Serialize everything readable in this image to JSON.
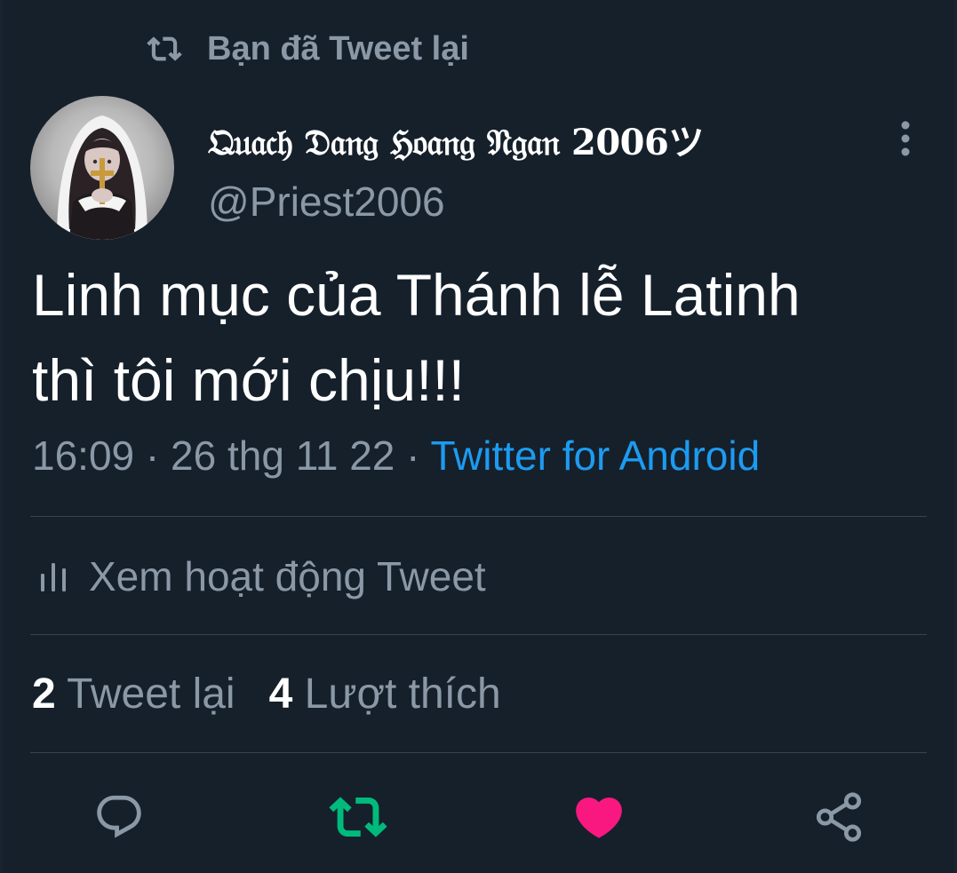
{
  "retweet_context": {
    "label": "Bạn đã Tweet lại",
    "icon": "retweet-icon"
  },
  "author": {
    "display_name": "𝔔𝔲𝔞𝔠𝔥 𝔇𝔞𝔫𝔤 ℌ𝔬𝔞𝔫𝔤 𝔑𝔤𝔞𝔫 2006ツ",
    "handle": "@Priest2006"
  },
  "tweet": {
    "line1": "Linh mục của Thánh lễ Latinh",
    "line2": "thì tôi mới chịu!!!"
  },
  "meta": {
    "time": "16:09",
    "separator": " · ",
    "date": "26 thg 11 22",
    "source": "Twitter for Android"
  },
  "activity": {
    "label": "Xem hoạt động Tweet",
    "icon": "analytics-bars-icon"
  },
  "stats": {
    "retweets_count": "2",
    "retweets_label": "Tweet lại",
    "likes_count": "4",
    "likes_label": "Lượt thích"
  },
  "actions": [
    {
      "name": "reply",
      "icon": "reply-bubble-icon"
    },
    {
      "name": "retweet",
      "icon": "retweet-icon",
      "active": true
    },
    {
      "name": "like",
      "icon": "heart-icon",
      "active": true
    },
    {
      "name": "share",
      "icon": "share-icon"
    }
  ],
  "colors": {
    "background": "#15202b",
    "text_primary": "#ffffff",
    "text_secondary": "#8b98a5",
    "link": "#1d9bf0",
    "retweet_active": "#00ba7c",
    "like_active": "#f91880",
    "divider": "#38444d"
  }
}
